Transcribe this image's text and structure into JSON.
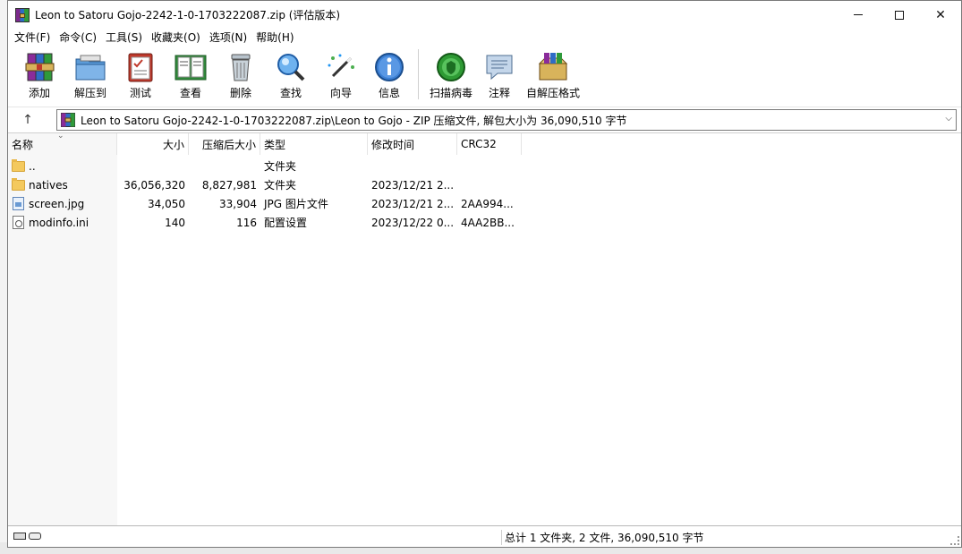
{
  "window": {
    "title": "Leon to Satoru Gojo-2242-1-0-1703222087.zip (评估版本)",
    "controls": [
      "minimize",
      "maximize",
      "close"
    ]
  },
  "menu": [
    "文件(F)",
    "命令(C)",
    "工具(S)",
    "收藏夹(O)",
    "选项(N)",
    "帮助(H)"
  ],
  "toolbar": {
    "add": "添加",
    "extract_to": "解压到",
    "test": "测试",
    "view": "查看",
    "delete": "删除",
    "find": "查找",
    "wizard": "向导",
    "info": "信息",
    "virus_scan": "扫描病毒",
    "comment": "注释",
    "sfx": "自解压格式"
  },
  "address": {
    "path": "Leon to Satoru Gojo-2242-1-0-1703222087.zip\\Leon to Gojo - ZIP 压缩文件, 解包大小为 36,090,510 字节"
  },
  "columns": {
    "name": "名称",
    "size": "大小",
    "packed": "压缩后大小",
    "type": "类型",
    "modified": "修改时间",
    "crc": "CRC32"
  },
  "files": [
    {
      "name": "..",
      "size": "",
      "packed": "",
      "type": "文件夹",
      "modified": "",
      "crc": "",
      "icon": "folder-icon"
    },
    {
      "name": "natives",
      "size": "36,056,320",
      "packed": "8,827,981",
      "type": "文件夹",
      "modified": "2023/12/21 2...",
      "crc": "",
      "icon": "folder-icon"
    },
    {
      "name": "screen.jpg",
      "size": "34,050",
      "packed": "33,904",
      "type": "JPG 图片文件",
      "modified": "2023/12/21 2...",
      "crc": "2AA994...",
      "icon": "image-file-icon"
    },
    {
      "name": "modinfo.ini",
      "size": "140",
      "packed": "116",
      "type": "配置设置",
      "modified": "2023/12/22 0...",
      "crc": "4AA2BB...",
      "icon": "config-file-icon"
    }
  ],
  "status": {
    "summary": "总计 1 文件夹, 2 文件, 36,090,510 字节"
  }
}
